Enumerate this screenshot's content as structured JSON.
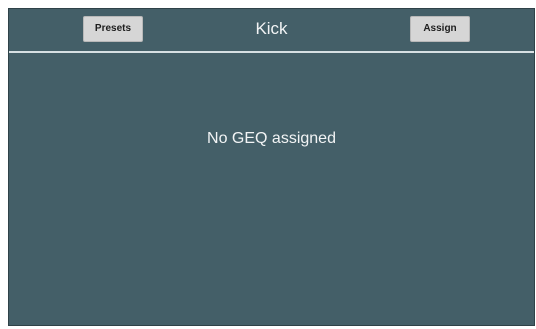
{
  "header": {
    "presets_label": "Presets",
    "title": "Kick",
    "assign_label": "Assign"
  },
  "main": {
    "message": "No GEQ assigned"
  },
  "colors": {
    "panel_background": "#445f68",
    "header_divider": "#d7e0e3",
    "button_background": "#d6d6d6",
    "text": "#f2f4f5"
  }
}
